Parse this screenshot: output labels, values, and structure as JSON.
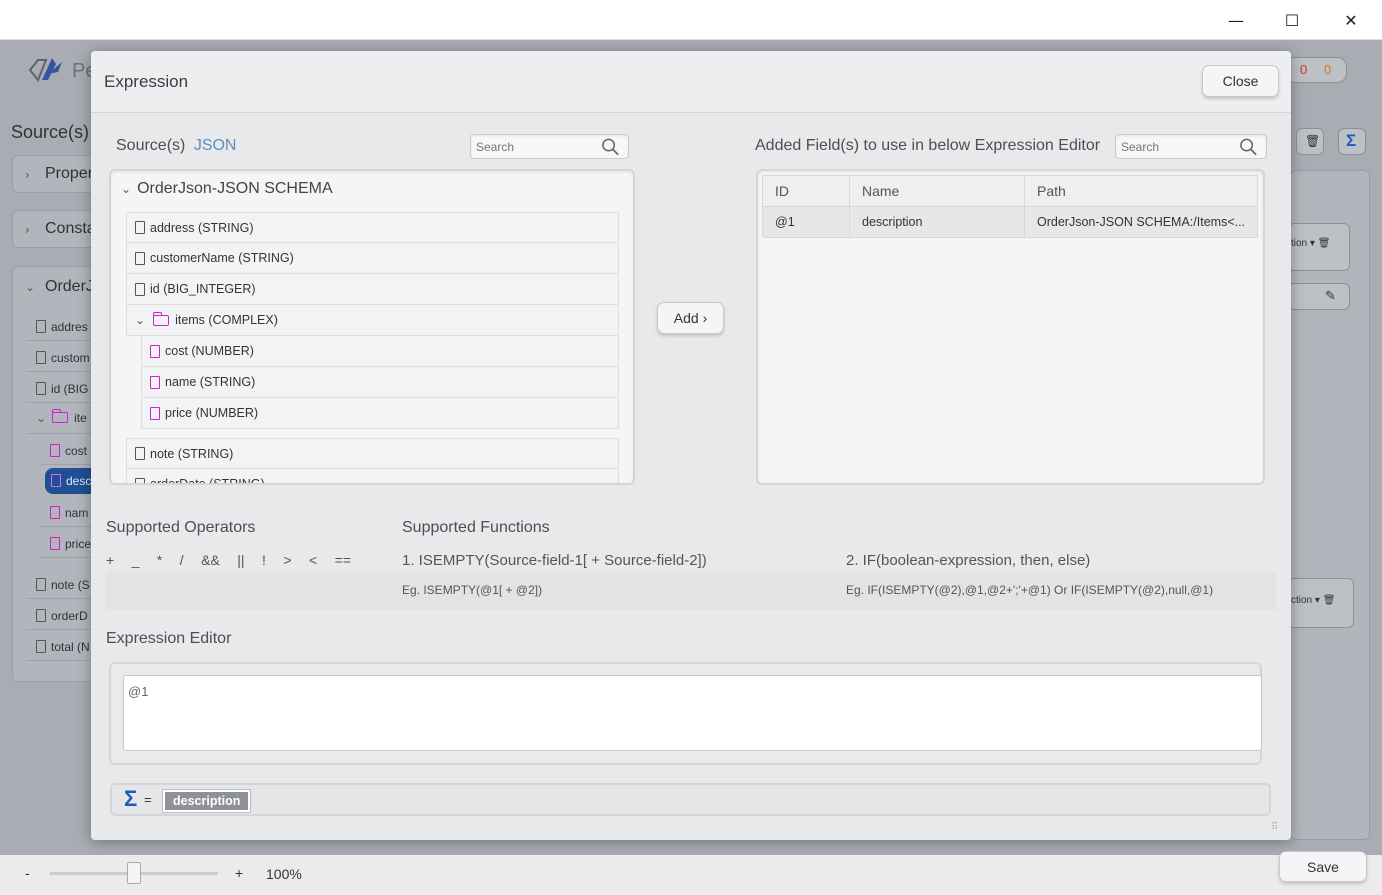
{
  "window": {
    "minimize_glyph": "—",
    "maximize_glyph": "☐",
    "close_glyph": "✕"
  },
  "background": {
    "app_title_partial": "Pe",
    "sources_title": "Source(s)",
    "counters": [
      "0",
      "0"
    ],
    "accordion": [
      "Proper",
      "Consta",
      "OrderJ"
    ],
    "tree": [
      {
        "label": "addres",
        "type": "doc"
      },
      {
        "label": "custom",
        "type": "doc"
      },
      {
        "label": "id (BIG",
        "type": "doc"
      },
      {
        "label": "ite",
        "type": "folder"
      },
      {
        "label": "cost",
        "type": "doc-pink"
      },
      {
        "label": "desc",
        "type": "doc-pink-selected"
      },
      {
        "label": "nam",
        "type": "doc-pink"
      },
      {
        "label": "price",
        "type": "doc-pink"
      },
      {
        "label": "note (S",
        "type": "doc"
      },
      {
        "label": "orderD",
        "type": "doc"
      },
      {
        "label": "total (N",
        "type": "doc"
      }
    ],
    "right_stub_1": "tion",
    "right_stub_2": "ction"
  },
  "modal": {
    "title": "Expression",
    "close_label": "Close",
    "sources": {
      "label": "Source(s)",
      "type_label": "JSON",
      "search_placeholder": "Search",
      "root": "OrderJson-JSON SCHEMA",
      "fields": [
        {
          "label": "address (STRING)",
          "kind": "doc",
          "level": 0
        },
        {
          "label": "customerName (STRING)",
          "kind": "doc",
          "level": 0
        },
        {
          "label": "id (BIG_INTEGER)",
          "kind": "doc",
          "level": 0
        },
        {
          "label": "items (COMPLEX)",
          "kind": "folder",
          "level": 0
        },
        {
          "label": "cost (NUMBER)",
          "kind": "doc-pink",
          "level": 1
        },
        {
          "label": "name (STRING)",
          "kind": "doc-pink",
          "level": 1
        },
        {
          "label": "price (NUMBER)",
          "kind": "doc-pink",
          "level": 1
        },
        {
          "label": "note (STRING)",
          "kind": "doc",
          "level": 0
        },
        {
          "label": "orderDate (STRING)",
          "kind": "doc",
          "level": 0
        }
      ]
    },
    "add_label": "Add ›",
    "added": {
      "label": "Added Field(s) to use in below Expression Editor",
      "search_placeholder": "Search",
      "columns": [
        "ID",
        "Name",
        "Path"
      ],
      "rows": [
        {
          "id": "@1",
          "name": "description",
          "path": "OrderJson-JSON SCHEMA:/Items<..."
        }
      ]
    },
    "operators": {
      "label": "Supported Operators",
      "items": [
        "+",
        "_",
        "*",
        "/",
        "&&",
        "||",
        "!",
        ">",
        "<",
        "=="
      ]
    },
    "functions": {
      "label": "Supported Functions",
      "f1": "1. ISEMPTY(Source-field-1[ + Source-field-2])",
      "f1_eg": "Eg. ISEMPTY(@1[ + @2])",
      "f2": "2. IF(boolean-expression, then, else)",
      "f2_eg": "Eg. IF(ISEMPTY(@2),@1,@2+';'+@1) Or IF(ISEMPTY(@2),null,@1)"
    },
    "editor": {
      "label": "Expression Editor",
      "value": "@1"
    },
    "result": {
      "sigma": "Σ",
      "equals": "=",
      "chip": "description"
    }
  },
  "bottom": {
    "minus": "-",
    "plus": "+",
    "zoom": "100%",
    "zoom_fraction": 0.5,
    "save_label": "Save"
  }
}
